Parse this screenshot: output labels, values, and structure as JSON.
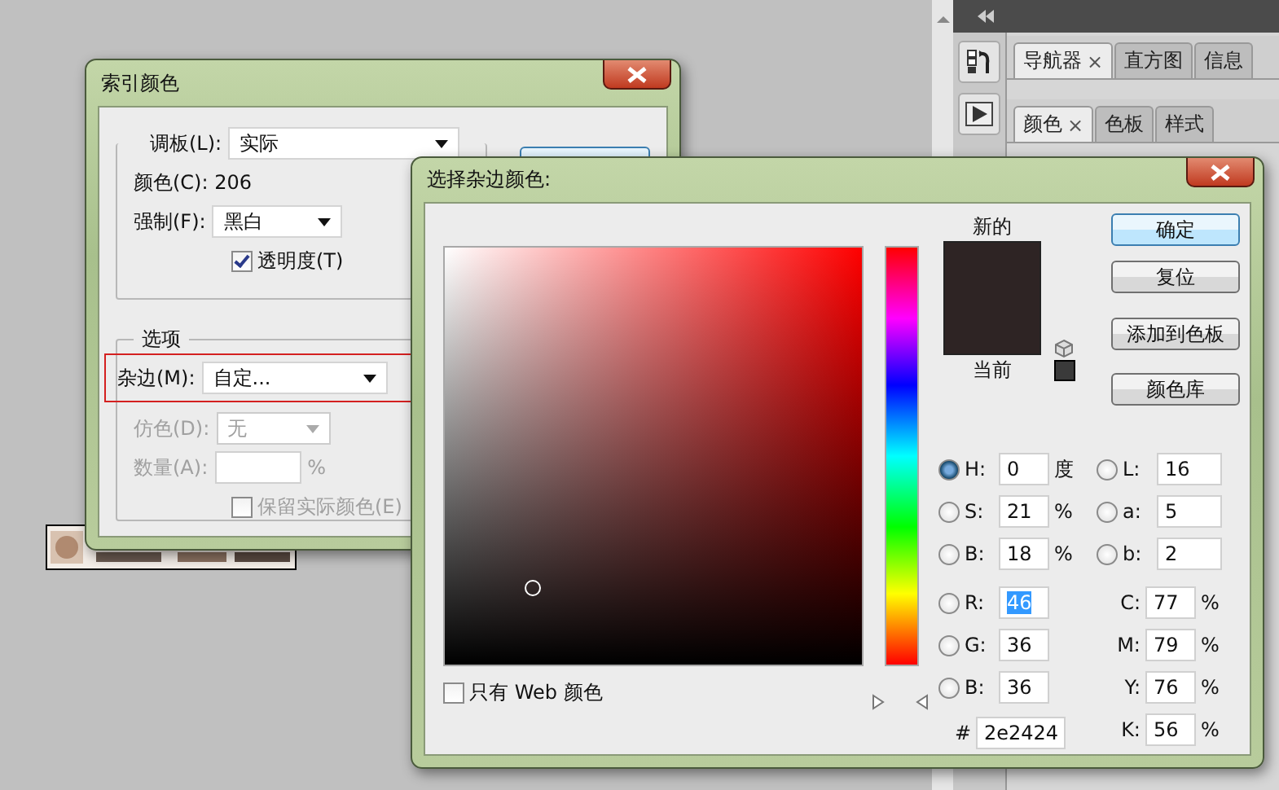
{
  "panel_tab_groups": [
    {
      "tabs": [
        {
          "label": "导航器",
          "close": "×",
          "selected": true
        },
        {
          "label": "直方图",
          "selected": false
        },
        {
          "label": "信息",
          "selected": false
        }
      ]
    },
    {
      "tabs": [
        {
          "label": "颜色",
          "close": "×",
          "selected": true
        },
        {
          "label": "色板",
          "selected": false
        },
        {
          "label": "样式",
          "selected": false
        }
      ]
    }
  ],
  "index_dialog": {
    "title": "索引颜色",
    "palette": {
      "label": "调板(L):",
      "value": "实际"
    },
    "colors": {
      "label": "颜色(C):",
      "value": "206"
    },
    "forced": {
      "label": "强制(F):",
      "value": "黑白"
    },
    "transparency": {
      "label": "透明度(T)",
      "checked": true
    },
    "options_title": "选项",
    "matte": {
      "label": "杂边(M):",
      "value": "自定...",
      "highlighted": true
    },
    "dither": {
      "label": "仿色(D):",
      "value": "无",
      "disabled": true
    },
    "amount": {
      "label": "数量(A):",
      "unit": "%",
      "disabled": true
    },
    "preserve": {
      "label": "保留实际颜色(E)",
      "checked": false,
      "disabled": true
    }
  },
  "picker_dialog": {
    "title": "选择杂边颜色:",
    "new_label": "新的",
    "current_label": "当前",
    "buttons": [
      {
        "label": "确定",
        "default": true
      },
      {
        "label": "复位",
        "default": false
      },
      {
        "label": "添加到色板",
        "default": false
      },
      {
        "label": "颜色库",
        "default": false
      }
    ],
    "left_fields": [
      {
        "kind": "radio",
        "label": "H:",
        "value": "0",
        "unit": "度",
        "selected": true,
        "text_selected": false
      },
      {
        "kind": "radio",
        "label": "S:",
        "value": "21",
        "unit": "%",
        "selected": false,
        "text_selected": false
      },
      {
        "kind": "radio",
        "label": "B:",
        "value": "18",
        "unit": "%",
        "selected": false,
        "text_selected": false
      },
      {
        "kind": "radio",
        "label": "R:",
        "value": "46",
        "selected": false,
        "text_selected": true
      },
      {
        "kind": "radio",
        "label": "G:",
        "value": "36",
        "selected": false,
        "text_selected": false
      },
      {
        "kind": "radio",
        "label": "B:",
        "value": "36",
        "selected": false,
        "text_selected": false
      }
    ],
    "right_fields": [
      {
        "kind": "radio",
        "label": "L:",
        "value": "16",
        "selected": false
      },
      {
        "kind": "radio",
        "label": "a:",
        "value": "5",
        "selected": false
      },
      {
        "kind": "radio",
        "label": "b:",
        "value": "2",
        "selected": false
      },
      {
        "kind": "plain",
        "label": "C:",
        "value": "77",
        "unit": "%"
      },
      {
        "kind": "plain",
        "label": "M:",
        "value": "79",
        "unit": "%"
      },
      {
        "kind": "plain",
        "label": "Y:",
        "value": "76",
        "unit": "%"
      },
      {
        "kind": "plain",
        "label": "K:",
        "value": "56",
        "unit": "%"
      }
    ],
    "hex": {
      "label": "#",
      "value": "2e2424"
    },
    "web_only": {
      "label": "只有 Web 颜色",
      "checked": false
    }
  }
}
